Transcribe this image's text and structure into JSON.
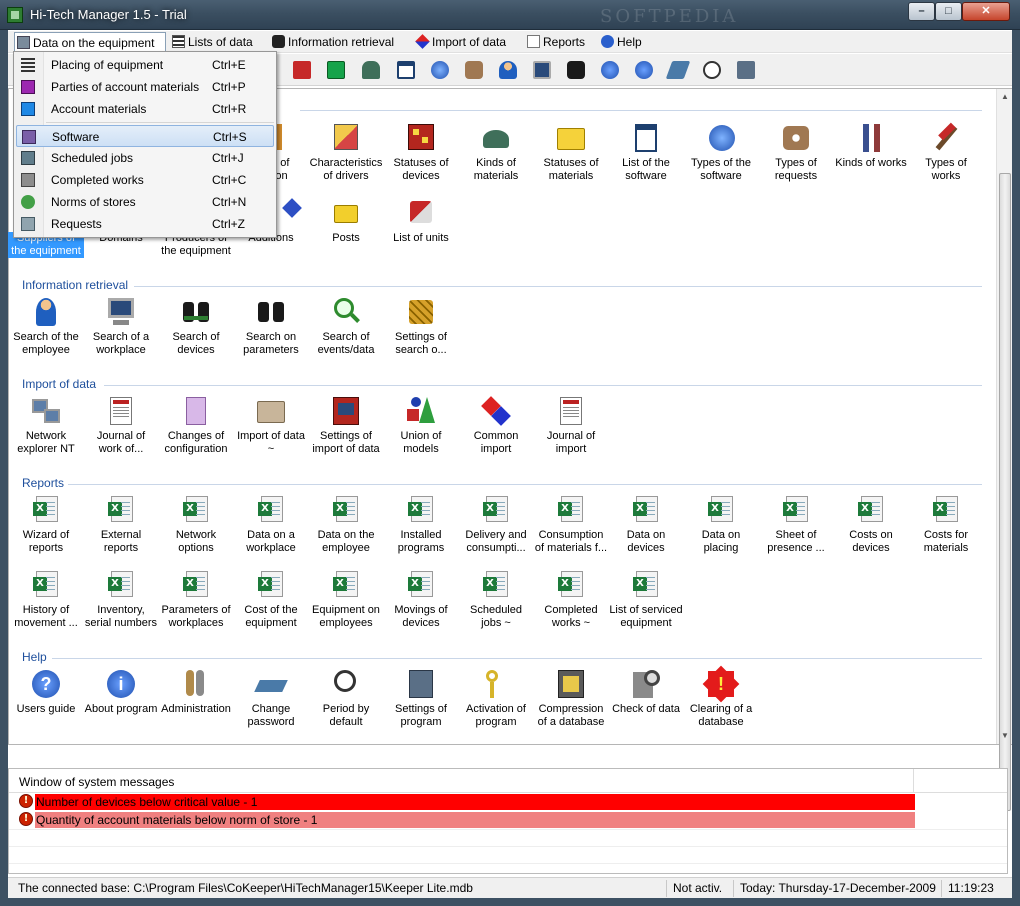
{
  "window": {
    "title": "Hi-Tech Manager 1.5 - Trial",
    "watermark": "SOFTPEDIA",
    "min_label": "–",
    "max_label": "□",
    "close_label": "✕"
  },
  "menubar": [
    {
      "label": "Data on the equipment",
      "icon": "equipment-icon"
    },
    {
      "label": "Lists of data",
      "icon": "list-icon"
    },
    {
      "label": "Information retrieval",
      "icon": "binoculars-icon"
    },
    {
      "label": "Import of data",
      "icon": "import-icon"
    },
    {
      "label": "Reports",
      "icon": "report-icon"
    },
    {
      "label": "Help",
      "icon": "help-icon"
    }
  ],
  "dropdown": [
    {
      "label": "Placing of equipment",
      "shortcut": "Ctrl+E"
    },
    {
      "label": "Parties of account materials",
      "shortcut": "Ctrl+P"
    },
    {
      "label": "Account materials",
      "shortcut": "Ctrl+R"
    },
    {
      "label": "Software",
      "shortcut": "Ctrl+S"
    },
    {
      "label": "Scheduled jobs",
      "shortcut": "Ctrl+J"
    },
    {
      "label": "Completed works",
      "shortcut": "Ctrl+C"
    },
    {
      "label": "Norms of stores",
      "shortcut": "Ctrl+N"
    },
    {
      "label": "Requests",
      "shortcut": "Ctrl+Z"
    }
  ],
  "lists": {
    "row1": [
      {
        "line1": "…ns of",
        "line2": "…ition"
      },
      {
        "line1": "Characteristics",
        "line2": "of drivers"
      },
      {
        "line1": "Statuses of",
        "line2": "devices"
      },
      {
        "line1": "Kinds of",
        "line2": "materials"
      },
      {
        "line1": "Statuses of",
        "line2": "materials"
      },
      {
        "line1": "List of the",
        "line2": "software"
      },
      {
        "line1": "Types of the",
        "line2": "software"
      },
      {
        "line1": "Types of",
        "line2": "requests"
      },
      {
        "line1": "Kinds of works",
        "line2": ""
      },
      {
        "line1": "Types of",
        "line2": "works"
      }
    ],
    "row2": [
      {
        "line1": "Suppliers of",
        "line2": "the equipment"
      },
      {
        "line1": "Domains",
        "line2": ""
      },
      {
        "line1": "Producers of",
        "line2": "the equipment"
      },
      {
        "line1": "Additions",
        "line2": ""
      },
      {
        "line1": "Posts",
        "line2": ""
      },
      {
        "line1": "List of units",
        "line2": ""
      }
    ]
  },
  "sections": {
    "retrieval": {
      "title": "Information retrieval",
      "items": [
        {
          "line1": "Search of the",
          "line2": "employee"
        },
        {
          "line1": "Search of a",
          "line2": "workplace"
        },
        {
          "line1": "Search of",
          "line2": "devices"
        },
        {
          "line1": "Search on",
          "line2": "parameters"
        },
        {
          "line1": "Search of",
          "line2": "events/data"
        },
        {
          "line1": "Settings of",
          "line2": "search o..."
        }
      ]
    },
    "import": {
      "title": "Import of data",
      "items": [
        {
          "line1": "Network",
          "line2": "explorer NT"
        },
        {
          "line1": "Journal of",
          "line2": "work of..."
        },
        {
          "line1": "Changes of",
          "line2": "configuration"
        },
        {
          "line1": "Import of data",
          "line2": "~"
        },
        {
          "line1": "Settings of",
          "line2": "import of data"
        },
        {
          "line1": "Union of",
          "line2": "models"
        },
        {
          "line1": "Common",
          "line2": "import"
        },
        {
          "line1": "Journal of",
          "line2": "import"
        }
      ]
    },
    "reports": {
      "title": "Reports",
      "row1": [
        {
          "line1": "Wizard of",
          "line2": "reports"
        },
        {
          "line1": "External",
          "line2": "reports"
        },
        {
          "line1": "Network",
          "line2": "options"
        },
        {
          "line1": "Data on a",
          "line2": "workplace"
        },
        {
          "line1": "Data on the",
          "line2": "employee"
        },
        {
          "line1": "Installed",
          "line2": "programs"
        },
        {
          "line1": "Delivery and",
          "line2": "consumpti..."
        },
        {
          "line1": "Consumption",
          "line2": "of materials f..."
        },
        {
          "line1": "Data on",
          "line2": "devices"
        },
        {
          "line1": "Data on",
          "line2": "placing"
        },
        {
          "line1": "Sheet of",
          "line2": "presence ..."
        },
        {
          "line1": "Costs on",
          "line2": "devices"
        },
        {
          "line1": "Costs for",
          "line2": "materials"
        }
      ],
      "row2": [
        {
          "line1": "History of",
          "line2": "movement ..."
        },
        {
          "line1": "Inventory,",
          "line2": "serial numbers"
        },
        {
          "line1": "Parameters of",
          "line2": "workplaces"
        },
        {
          "line1": "Cost of the",
          "line2": "equipment"
        },
        {
          "line1": "Equipment on",
          "line2": "employees"
        },
        {
          "line1": "Movings of",
          "line2": "devices"
        },
        {
          "line1": "Scheduled",
          "line2": "jobs ~"
        },
        {
          "line1": "Completed",
          "line2": "works ~"
        },
        {
          "line1": "List of serviced",
          "line2": "equipment"
        }
      ]
    },
    "help": {
      "title": "Help",
      "items": [
        {
          "line1": "Users guide",
          "line2": ""
        },
        {
          "line1": "About program",
          "line2": ""
        },
        {
          "line1": "Administration",
          "line2": ""
        },
        {
          "line1": "Change",
          "line2": "password"
        },
        {
          "line1": "Period by",
          "line2": "default"
        },
        {
          "line1": "Settings of",
          "line2": "program"
        },
        {
          "line1": "Activation of",
          "line2": "program"
        },
        {
          "line1": "Compression",
          "line2": "of a database"
        },
        {
          "line1": "Check of data",
          "line2": ""
        },
        {
          "line1": "Clearing of a",
          "line2": "database"
        }
      ]
    }
  },
  "messages": {
    "title": "Window of system messages",
    "rows": [
      {
        "text": "Number of devices below critical value - 1",
        "level": "critical"
      },
      {
        "text": "Quantity of account materials below norm of store - 1",
        "level": "warning"
      }
    ]
  },
  "statusbar": {
    "base": "The connected base: C:\\Program Files\\CoKeeper\\HiTechManager15\\Keeper Lite.mdb",
    "activation": "Not activ.",
    "today": "Today: Thursday-17-December-2009",
    "time": "11:19:23"
  },
  "colors": {
    "critical": "#ff0000",
    "warning": "#f08080",
    "section_title": "#1e4f9c",
    "selection": "#3399ff"
  }
}
